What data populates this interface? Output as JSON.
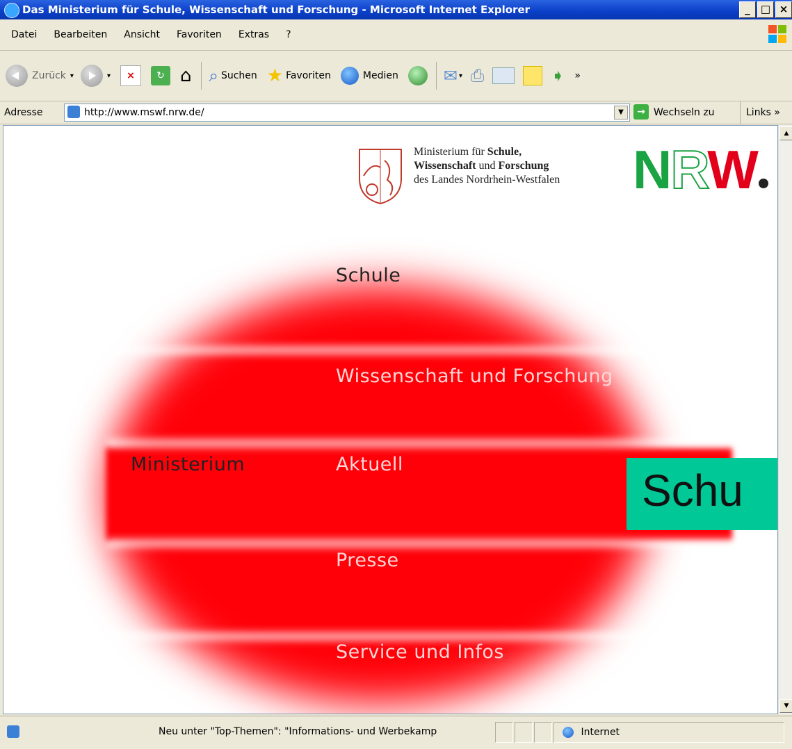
{
  "window": {
    "title": "Das Ministerium für Schule, Wissenschaft und Forschung - Microsoft Internet Explorer"
  },
  "menu": [
    "Datei",
    "Bearbeiten",
    "Ansicht",
    "Favoriten",
    "Extras",
    "?"
  ],
  "toolbar": {
    "back_label": "Zurück",
    "search_label": "Suchen",
    "favorites_label": "Favoriten",
    "media_label": "Medien"
  },
  "address": {
    "label": "Adresse",
    "url": "http://www.mswf.nrw.de/",
    "go_label": "Wechseln zu",
    "links_label": "Links"
  },
  "page": {
    "ministry_line1": "Ministerium für ",
    "ministry_line1_bold": "Schule,",
    "ministry_line2_bold1": "Wissenschaft",
    "ministry_line2_mid": " und ",
    "ministry_line2_bold2": "Forschung",
    "ministry_line3": "des Landes Nordrhein-Westfalen",
    "nrw_logo": "NRW",
    "nav": {
      "schule": "Schule",
      "wissenschaft": "Wissenschaft und Forschung",
      "ministerium": "Ministerium",
      "aktuell": "Aktuell",
      "presse": "Presse",
      "service": "Service und Infos"
    },
    "overlay_text": "Schu"
  },
  "status": {
    "message": "Neu unter \"Top-Themen\": \"Informations- und Werbekamp",
    "zone": "Internet"
  },
  "colors": {
    "blob": "#ff0008",
    "overlay": "#00c896",
    "nrw_green": "#1aa342",
    "nrw_red": "#e2001a"
  }
}
